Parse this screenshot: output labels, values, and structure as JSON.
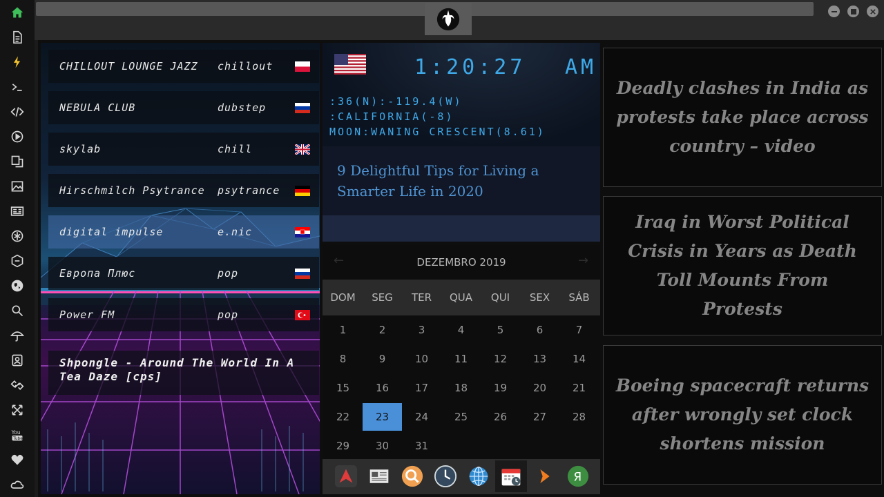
{
  "sidebar": {
    "items": [
      {
        "icon": "home-icon"
      },
      {
        "icon": "document-icon"
      },
      {
        "icon": "lightning-icon"
      },
      {
        "icon": "terminal-icon"
      },
      {
        "icon": "code-icon"
      },
      {
        "icon": "play-icon"
      },
      {
        "icon": "translate-icon"
      },
      {
        "icon": "image-icon"
      },
      {
        "icon": "newspaper-icon"
      },
      {
        "icon": "rebel-icon"
      },
      {
        "icon": "hexagon-icon"
      },
      {
        "icon": "globe-icon"
      },
      {
        "icon": "search-icon"
      },
      {
        "icon": "umbrella-icon"
      },
      {
        "icon": "contacts-icon"
      },
      {
        "icon": "link-icon"
      },
      {
        "icon": "expand-icon"
      },
      {
        "icon": "youtube-icon"
      },
      {
        "icon": "heart-icon"
      },
      {
        "icon": "cloud-icon"
      }
    ],
    "accent_color": "#3fbf5a",
    "lightning_color": "#f2c230"
  },
  "radio": {
    "stations": [
      {
        "name": "CHILLOUT LOUNGE JAZZ",
        "genre": "chillout",
        "flag": "pl-flag-icon"
      },
      {
        "name": "NEBULA CLUB",
        "genre": "dubstep",
        "flag": "ru-flag-icon"
      },
      {
        "name": "skylab",
        "genre": "chill",
        "flag": "uk-flag-icon"
      },
      {
        "name": "Hirschmilch Psytrance",
        "genre": "psytrance",
        "flag": "de-flag-icon"
      },
      {
        "name": "digital impulse",
        "genre": "e.nic",
        "flag": "hr-flag-icon"
      },
      {
        "name": "Европа Плюс",
        "genre": "pop",
        "flag": "ru-flag-icon"
      },
      {
        "name": "Power FM",
        "genre": "pop",
        "flag": "tr-flag-icon"
      }
    ],
    "now_playing": "Shpongle - Around The World In A Tea Daze [cps]"
  },
  "clock": {
    "time": "1:20:27",
    "ampm": "AM",
    "coords": ":36(N):-119.4(W)",
    "region": ":CALIFORNIA(-8)",
    "moon": "MOON:WANING CRESCENT(8.61)",
    "flag": "us-flag-icon",
    "color": "#3fa9e8"
  },
  "article": {
    "title": "9 Delightful Tips for Living a Smarter Life in 2020"
  },
  "calendar": {
    "month_label": "DEZEMBRO 2019",
    "weekdays": [
      "DOM",
      "SEG",
      "TER",
      "QUA",
      "QUI",
      "SEX",
      "SÁB"
    ],
    "weeks": [
      [
        "1",
        "2",
        "3",
        "4",
        "5",
        "6",
        "7"
      ],
      [
        "8",
        "9",
        "10",
        "11",
        "12",
        "13",
        "14"
      ],
      [
        "15",
        "16",
        "17",
        "18",
        "19",
        "20",
        "21"
      ],
      [
        "22",
        "23",
        "24",
        "25",
        "26",
        "27",
        "28"
      ],
      [
        "29",
        "30",
        "31"
      ]
    ],
    "selected_day": "23",
    "selected_color": "#4a90d9"
  },
  "dock": {
    "apps": [
      "arch-app-icon",
      "news-app-icon",
      "search-app-icon",
      "clock-app-icon",
      "browser-app-icon",
      "calendar-app-icon",
      "arrow-app-icon",
      "yandex-app-icon"
    ]
  },
  "news": [
    "Deadly clashes in India as protests take place across country – video",
    "Iraq in Worst Political Crisis in Years as Death Toll Mounts From Protests",
    "Boeing spacecraft returns after wrongly set clock shortens mission"
  ]
}
